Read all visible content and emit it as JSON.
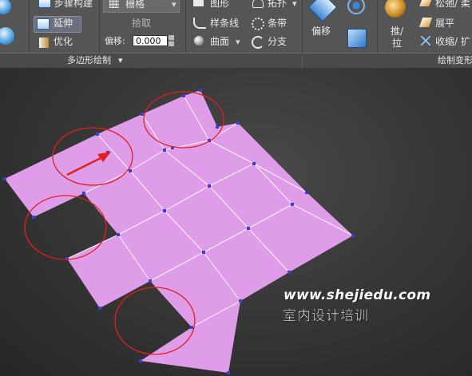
{
  "ribbon": {
    "items": {
      "step_build": "步骤构建",
      "extend": "延伸",
      "optimize": "优化",
      "grid": "栅格",
      "pick": "拾取",
      "offset_label": "偏移:",
      "offset_value": "0.000",
      "shape": "图形",
      "spline": "样条线",
      "surface": "曲面",
      "topology": "拓扑",
      "strip": "条带",
      "branch": "分支",
      "offset_btn": "偏移",
      "push_pull_1": "推/",
      "push_pull_2": "拉",
      "relax": "松弛/ 柔",
      "flatten": "展平",
      "shrink": "收缩/ 扩"
    },
    "footer": {
      "poly_draw": "多边形绘制",
      "paint_deform": "绘制变形"
    }
  },
  "watermark": {
    "url": "www.shejiedu.com",
    "name": "室内设计培训"
  },
  "colors": {
    "ribbon_bg": "#555555",
    "mesh_fill": "#df9ce9",
    "edge": "#ffffff",
    "vertex": "#3e3ed2",
    "annotation": "#e02020"
  }
}
